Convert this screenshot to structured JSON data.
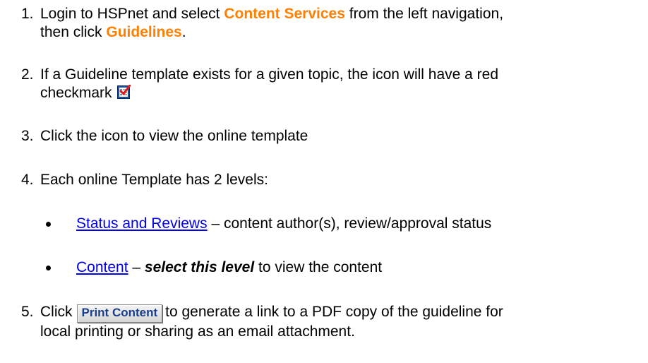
{
  "steps": [
    {
      "num": "1.",
      "pre": "Login to HSPnet and select ",
      "highlight1": "Content Services",
      "mid": " from the left navigation,",
      "line2_pre": "then click ",
      "highlight2": "Guidelines",
      "line2_post": "."
    },
    {
      "num": "2.",
      "line1": "If a Guideline template exists for a given topic, the icon will have a red",
      "line2": "checkmark"
    },
    {
      "num": "3.",
      "text": "Click the icon to view the online template"
    },
    {
      "num": "4.",
      "text": "Each online Template has 2 levels:"
    },
    {
      "num": "5.",
      "pre": "Click",
      "post": "to generate a link to a PDF copy of the guideline for",
      "line2": "local printing or sharing as an email attachment."
    }
  ],
  "bullets": [
    {
      "link": "Status and Reviews",
      "rest": " – content author(s), review/approval status"
    },
    {
      "link": "Content",
      "mid": " – ",
      "emph": "select this level",
      "rest": " to view the content"
    }
  ],
  "print_button_label": "Print Content",
  "icons": {
    "template_icon": "guideline-template-checkmark-icon",
    "checkmark_color": "#e01818"
  },
  "colors": {
    "highlight": "#ff7f00",
    "link": "#0000ee"
  }
}
